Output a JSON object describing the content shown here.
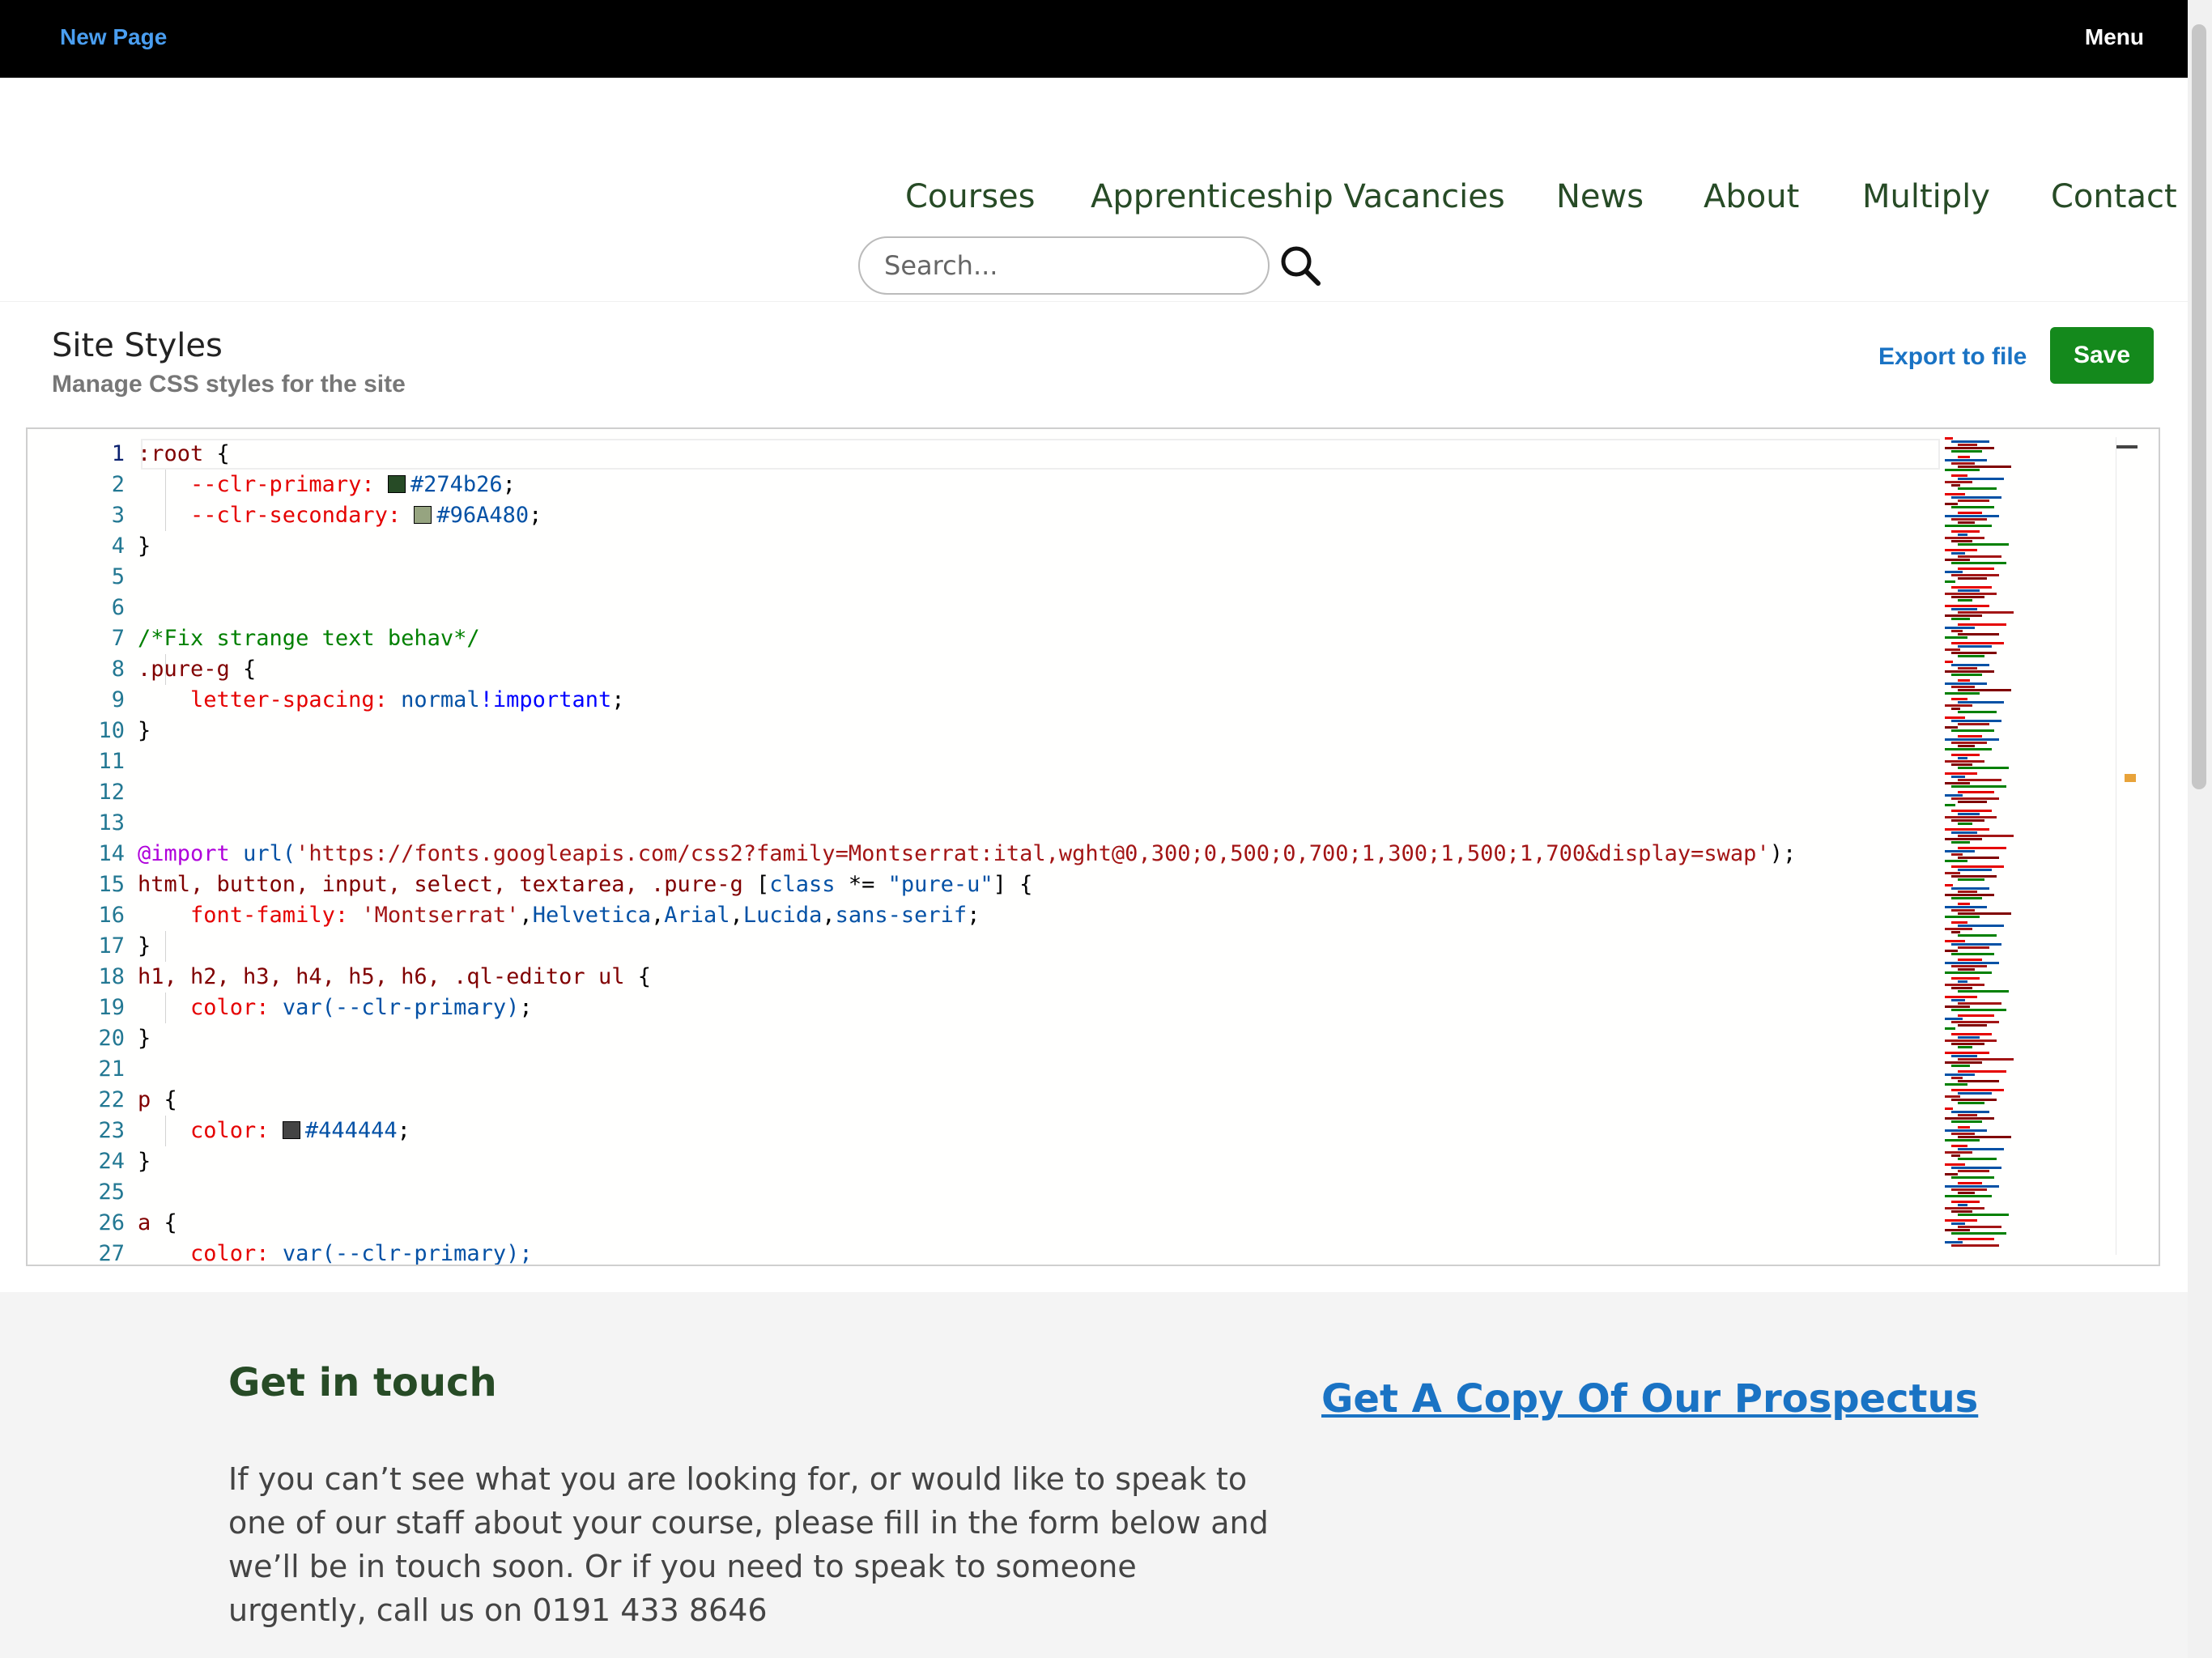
{
  "topbar": {
    "left_link": "New Page",
    "menu_label": "Menu"
  },
  "nav": {
    "items": [
      "Courses",
      "Apprenticeship Vacancies",
      "News",
      "About",
      "Multiply",
      "Contact"
    ]
  },
  "search": {
    "placeholder": "Search..."
  },
  "panel": {
    "title": "Site Styles",
    "subtitle": "Manage CSS styles for the site",
    "export_label": "Export to file",
    "save_label": "Save",
    "save_color": "#14891c"
  },
  "editor": {
    "line_numbers": [
      "1",
      "2",
      "3",
      "4",
      "5",
      "6",
      "7",
      "8",
      "9",
      "10",
      "11",
      "12",
      "13",
      "14",
      "15",
      "16",
      "17",
      "18",
      "19",
      "20",
      "21",
      "22",
      "23",
      "24",
      "25",
      "26",
      "27"
    ],
    "lines": [
      [
        {
          "t": ":root",
          "c": "sel"
        },
        {
          "t": " {",
          "c": ""
        }
      ],
      [
        {
          "t": "    --clr-primary: ",
          "c": "prop"
        },
        {
          "sw": "#274b26"
        },
        {
          "t": "#274b26",
          "c": "val"
        },
        {
          "t": ";",
          "c": ""
        }
      ],
      [
        {
          "t": "    --clr-secondary: ",
          "c": "prop"
        },
        {
          "sw": "#96A480"
        },
        {
          "t": "#96A480",
          "c": "val"
        },
        {
          "t": ";",
          "c": ""
        }
      ],
      [
        {
          "t": "}",
          "c": ""
        }
      ],
      [],
      [],
      [
        {
          "t": "/*Fix strange text behav*/",
          "c": "cmt"
        }
      ],
      [
        {
          "t": ".pure-g",
          "c": "sel"
        },
        {
          "t": " {",
          "c": ""
        }
      ],
      [
        {
          "t": "    letter-spacing: ",
          "c": "prop"
        },
        {
          "t": "normal",
          "c": "val"
        },
        {
          "t": "!important",
          "c": "kw"
        },
        {
          "t": ";",
          "c": ""
        }
      ],
      [
        {
          "t": "}",
          "c": ""
        }
      ],
      [],
      [],
      [],
      [
        {
          "t": "@import",
          "c": "at"
        },
        {
          "t": " ",
          "c": ""
        },
        {
          "t": "url(",
          "c": "val"
        },
        {
          "t": "'https://fonts.googleapis.com/css2?family=Montserrat:ital,wght@0,300;0,500;0,700;1,300;1,500;1,700&display=swap'",
          "c": "str"
        },
        {
          "t": ");",
          "c": ""
        }
      ],
      [
        {
          "t": "html, button, input, select, textarea, .pure-g ",
          "c": "sel"
        },
        {
          "t": "[",
          "c": ""
        },
        {
          "t": "class",
          "c": "val"
        },
        {
          "t": " *= ",
          "c": ""
        },
        {
          "t": "\"pure-u\"",
          "c": "val"
        },
        {
          "t": "] {",
          "c": ""
        }
      ],
      [
        {
          "t": "    font-family: ",
          "c": "prop"
        },
        {
          "t": "'Montserrat'",
          "c": "str"
        },
        {
          "t": ",",
          "c": ""
        },
        {
          "t": "Helvetica",
          "c": "val"
        },
        {
          "t": ",",
          "c": ""
        },
        {
          "t": "Arial",
          "c": "val"
        },
        {
          "t": ",",
          "c": ""
        },
        {
          "t": "Lucida",
          "c": "val"
        },
        {
          "t": ",",
          "c": ""
        },
        {
          "t": "sans-serif",
          "c": "val"
        },
        {
          "t": ";",
          "c": ""
        }
      ],
      [
        {
          "t": "}",
          "c": ""
        }
      ],
      [
        {
          "t": "h1, h2, h3, h4, h5, h6, .ql-editor ul",
          "c": "sel"
        },
        {
          "t": " {",
          "c": ""
        }
      ],
      [
        {
          "t": "    color: ",
          "c": "prop"
        },
        {
          "t": "var(--clr-primary)",
          "c": "val"
        },
        {
          "t": ";",
          "c": ""
        }
      ],
      [
        {
          "t": "}",
          "c": ""
        }
      ],
      [],
      [
        {
          "t": "p",
          "c": "sel"
        },
        {
          "t": " {",
          "c": ""
        }
      ],
      [
        {
          "t": "    color: ",
          "c": "prop"
        },
        {
          "sw": "#444444"
        },
        {
          "t": "#444444",
          "c": "val"
        },
        {
          "t": ";",
          "c": ""
        }
      ],
      [
        {
          "t": "}",
          "c": ""
        }
      ],
      [],
      [
        {
          "t": "a",
          "c": "sel"
        },
        {
          "t": " {",
          "c": ""
        }
      ],
      [
        {
          "t": "    color: ",
          "c": "prop"
        },
        {
          "t": "var(--clr-primary);",
          "c": "val"
        }
      ]
    ]
  },
  "footer": {
    "heading": "Get in touch",
    "text": "If you can’t see what you are looking for, or would like to speak to one of our staff about your course, please fill in the form below and we’ll be in touch soon. Or if you need to speak to someone urgently, call us on 0191 433 8646",
    "prospectus_link": "Get A Copy Of Our Prospectus"
  },
  "colors": {
    "primary": "#274b26",
    "link": "#1a73c4",
    "topbar": "#000000"
  }
}
